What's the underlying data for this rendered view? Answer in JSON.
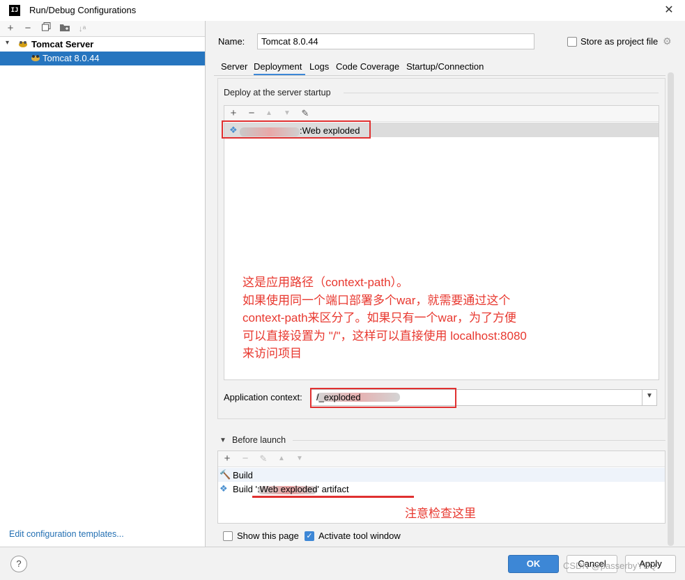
{
  "window": {
    "title": "Run/Debug Configurations",
    "app_icon": "IJ"
  },
  "left": {
    "tree": {
      "root_label": "Tomcat Server",
      "child_label": "Tomcat 8.0.44"
    },
    "edit_templates_label": "Edit configuration templates..."
  },
  "form": {
    "name_label": "Name:",
    "name_value": "Tomcat 8.0.44",
    "store_label": "Store as project file",
    "tabs": [
      "Server",
      "Deployment",
      "Logs",
      "Code Coverage",
      "Startup/Connection"
    ],
    "active_tab": "Deployment"
  },
  "deployment": {
    "group_title": "Deploy at the server startup",
    "artifact_suffix": ":Web exploded",
    "app_context_label": "Application context:",
    "app_context_value": "/_exploded"
  },
  "before_launch": {
    "group_title": "Before launch",
    "items": [
      "Build",
      "Build ':Web exploded' artifact"
    ]
  },
  "options": {
    "show_page_label": "Show this page",
    "activate_label": "Activate tool window"
  },
  "annotations": {
    "main": "这是应用路径（context-path）。\n如果使用同一个端口部署多个war，就需要通过这个\ncontext-path来区分了。如果只有一个war，为了方便\n可以直接设置为 \"/\"，这样可以直接使用 localhost:8080\n来访问项目",
    "check": "注意检查这里"
  },
  "buttons": {
    "ok": "OK",
    "cancel": "Cancel",
    "apply": "Apply",
    "help": "?"
  },
  "watermark": "CSDN @passerbyYSQ",
  "colors": {
    "selection": "#2675bf",
    "accent": "#3d87d6",
    "annotation_red": "#e8382f"
  }
}
